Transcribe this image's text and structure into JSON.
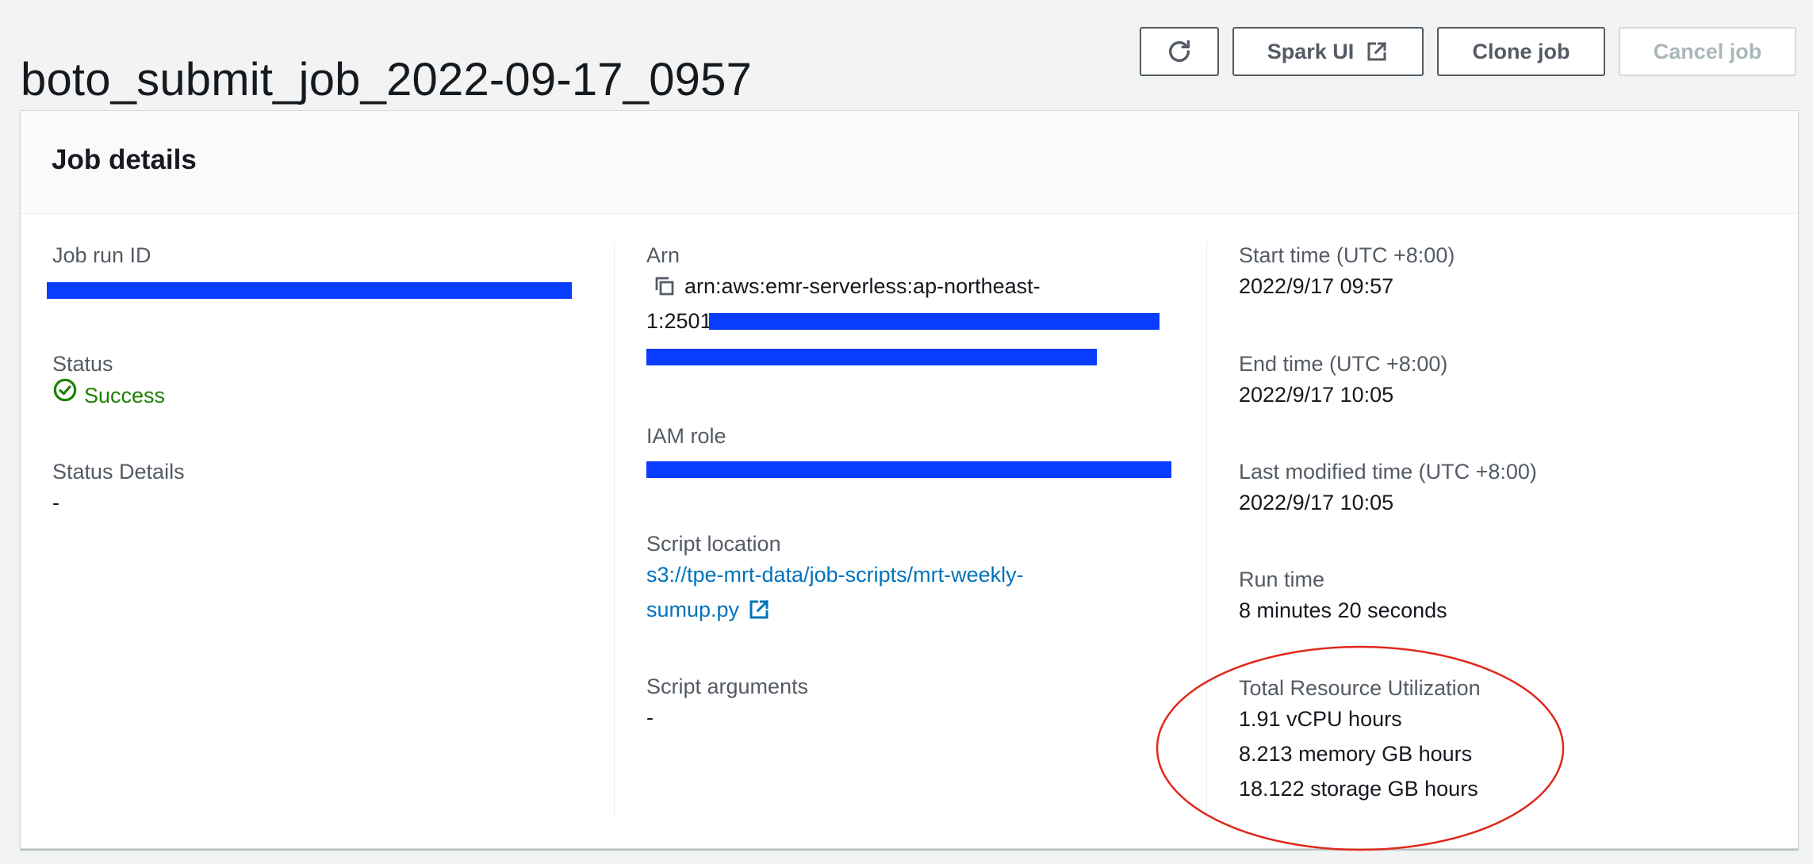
{
  "page": {
    "title": "boto_submit_job_2022-09-17_0957"
  },
  "actions": {
    "refresh_icon": "refresh-icon",
    "spark_ui_label": "Spark UI",
    "clone_job_label": "Clone job",
    "cancel_job_label": "Cancel job"
  },
  "panel": {
    "title": "Job details"
  },
  "details": {
    "job_run_id": {
      "label": "Job run ID"
    },
    "status": {
      "label": "Status",
      "value": "Success"
    },
    "status_details": {
      "label": "Status Details",
      "value": "-"
    },
    "arn": {
      "label": "Arn",
      "line1": "arn:aws:emr-serverless:ap-northeast-",
      "line2_prefix": "1:2501"
    },
    "iam_role": {
      "label": "IAM role"
    },
    "script_location": {
      "label": "Script location",
      "line1": "s3://tpe-mrt-data/job-scripts/mrt-weekly-",
      "line2": "sumup.py"
    },
    "script_arguments": {
      "label": "Script arguments",
      "value": "-"
    },
    "start_time": {
      "label": "Start time (UTC +8:00)",
      "value": "2022/9/17 09:57"
    },
    "end_time": {
      "label": "End time (UTC +8:00)",
      "value": "2022/9/17 10:05"
    },
    "last_modified_time": {
      "label": "Last modified time (UTC +8:00)",
      "value": "2022/9/17 10:05"
    },
    "run_time": {
      "label": "Run time",
      "value": "8 minutes 20 seconds"
    },
    "total_resource_utilization": {
      "label": "Total Resource Utilization",
      "vcpu": "1.91 vCPU hours",
      "memory": "8.213 memory GB hours",
      "storage": "18.122 storage GB hours"
    }
  },
  "colors": {
    "success": "#1d8102",
    "link": "#0073bb",
    "redaction": "#0a3cff",
    "annotation": "#e0281c"
  }
}
